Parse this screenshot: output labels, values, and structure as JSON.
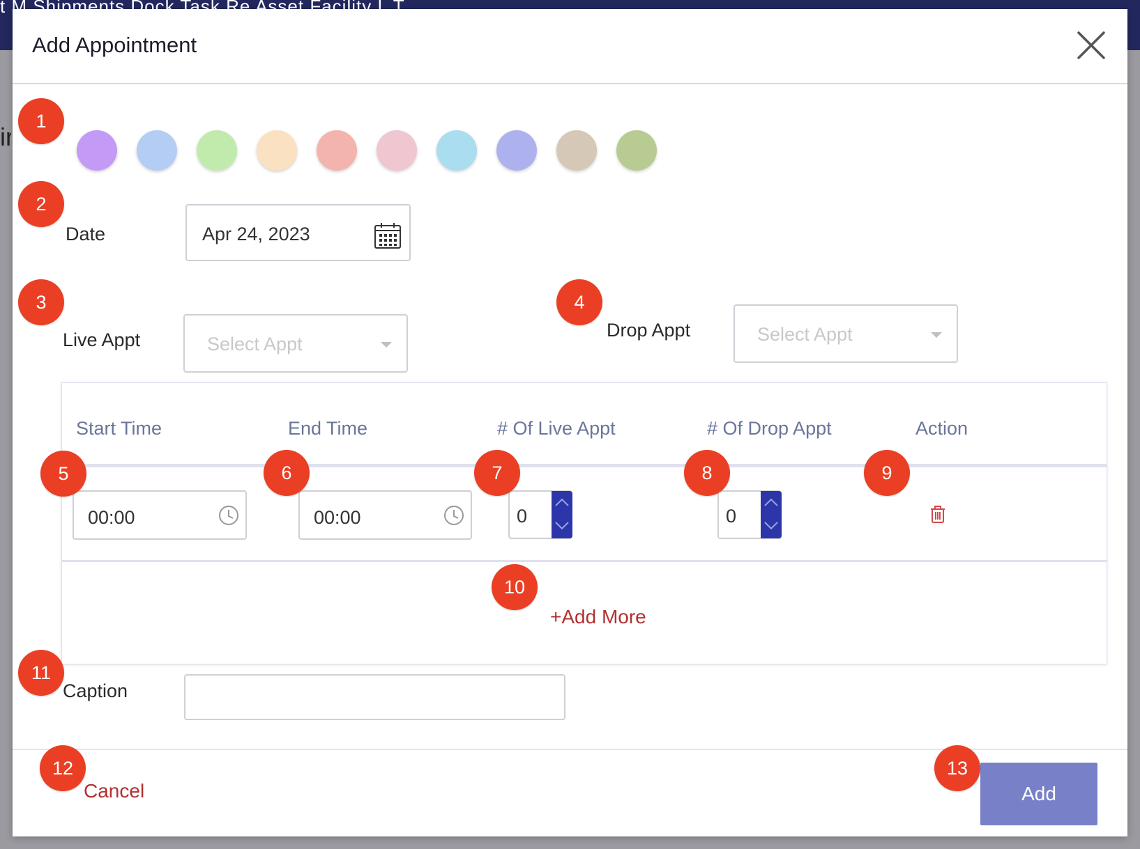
{
  "background": {
    "nav_fragment": "t M      Shipments      Dock      Task      Re       Asset      Facility      L T",
    "edge_fragment": "ir"
  },
  "modal": {
    "title": "Add Appointment"
  },
  "colors": {
    "swatches": [
      "#c39af6",
      "#b3cdf4",
      "#c1ebad",
      "#fae1c1",
      "#f4b4ae",
      "#f0c6d0",
      "#a9ddef",
      "#adb2ef",
      "#d5c8b6",
      "#b8cb92"
    ],
    "badge": "#ea3f24",
    "accent": "#7880c8",
    "stepper": "#2c36a8",
    "link": "#b33030"
  },
  "badges": [
    "1",
    "2",
    "3",
    "4",
    "5",
    "6",
    "7",
    "8",
    "9",
    "10",
    "11",
    "12",
    "13"
  ],
  "date": {
    "label": "Date",
    "value": "Apr 24, 2023",
    "icon": "calendar-icon"
  },
  "live_appt": {
    "label": "Live Appt",
    "placeholder": "Select Appt"
  },
  "drop_appt": {
    "label": "Drop Appt",
    "placeholder": "Select Appt"
  },
  "table": {
    "headers": [
      "Start Time",
      "End Time",
      "# Of Live Appt",
      "# Of Drop Appt",
      "Action"
    ],
    "rows": [
      {
        "start_time": "00:00",
        "end_time": "00:00",
        "live_count": "0",
        "drop_count": "0",
        "action_icon": "trash-icon"
      }
    ],
    "add_more_label": "+Add More"
  },
  "caption": {
    "label": "Caption",
    "value": ""
  },
  "footer": {
    "cancel_label": "Cancel",
    "add_label": "Add"
  }
}
